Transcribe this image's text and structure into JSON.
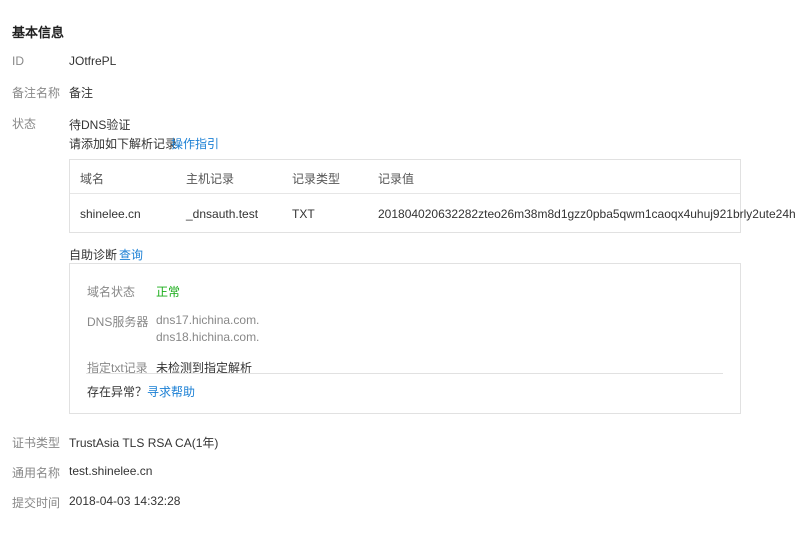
{
  "section_title": "基本信息",
  "basic": {
    "id_label": "ID",
    "id_value": "JOtfrePL",
    "remark_label": "备注名称",
    "remark_value": "备注",
    "status_label": "状态",
    "status_value": "待DNS验证",
    "add_record_text": "请添加如下解析记录",
    "guide_link": "操作指引"
  },
  "dns_table": {
    "headers": [
      "域名",
      "主机记录",
      "记录类型",
      "记录值"
    ],
    "row": [
      "shinelee.cn",
      "_dnsauth.test",
      "TXT",
      "201804020632282zteo26m38m8d1gzz0pba5qwm1caoqx4uhuj921brly2ute24h"
    ]
  },
  "diagnosis": {
    "label": "自助诊断",
    "query_link": "查询",
    "domain_status_label": "域名状态",
    "domain_status_value": "正常",
    "dns_server_label": "DNS服务器",
    "dns_servers": [
      "dns17.hichina.com.",
      "dns18.hichina.com."
    ],
    "txt_record_label": "指定txt记录",
    "txt_record_value": "未检测到指定解析",
    "anomaly_text": "存在异常？",
    "help_link": "寻求帮助"
  },
  "cert": {
    "type_label": "证书类型",
    "type_value": "TrustAsia TLS RSA CA(1年)",
    "common_name_label": "通用名称",
    "common_name_value": "test.shinelee.cn",
    "submit_time_label": "提交时间",
    "submit_time_value": "2018-04-03 14:32:28"
  },
  "colors": {
    "link": "#1a7fd4",
    "ok": "#1aad19",
    "border": "#e1e1e1"
  }
}
